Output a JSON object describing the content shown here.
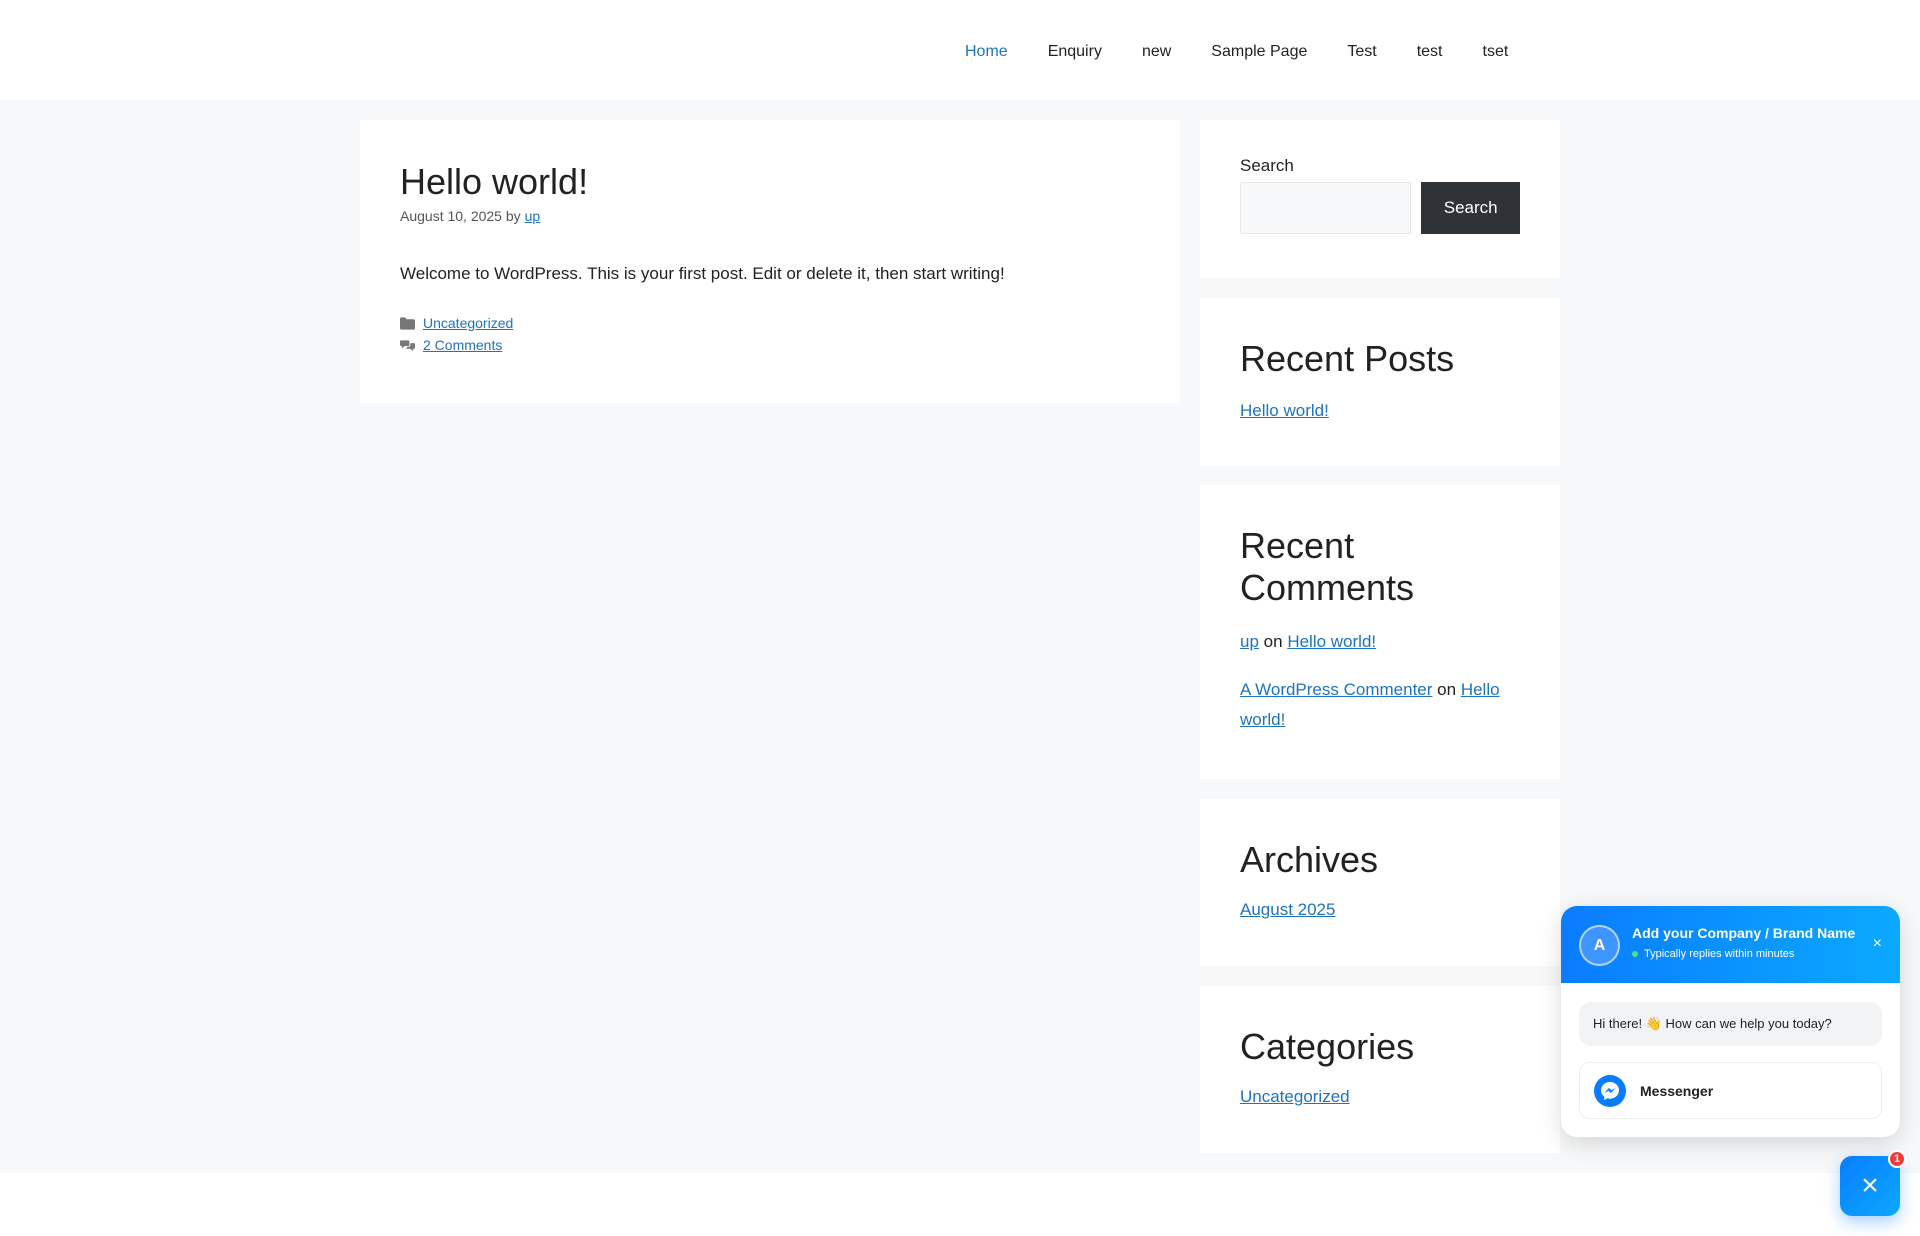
{
  "nav": {
    "items": [
      {
        "label": "Home"
      },
      {
        "label": "Enquiry"
      },
      {
        "label": "new"
      },
      {
        "label": "Sample Page"
      },
      {
        "label": "Test"
      },
      {
        "label": "test"
      },
      {
        "label": "tset"
      }
    ],
    "active": "Home"
  },
  "post": {
    "title": "Hello world!",
    "date": "August 10, 2025",
    "by": "by",
    "author": "up",
    "body": "Welcome to WordPress. This is your first post. Edit or delete it, then start writing!",
    "category": "Uncategorized",
    "comments": "2 Comments",
    "category_icon": "folder-icon",
    "comments_icon": "comments-icon"
  },
  "sidebar": {
    "search": {
      "label": "Search",
      "button": "Search",
      "value": ""
    },
    "recent_posts": {
      "title": "Recent Posts",
      "items": [
        "Hello world!"
      ]
    },
    "recent_comments": {
      "title": "Recent Comments",
      "items": [
        {
          "author": "up",
          "on": "on",
          "post": "Hello world!"
        },
        {
          "author": "A WordPress Commenter",
          "on": "on",
          "post": "Hello world!"
        }
      ]
    },
    "archives": {
      "title": "Archives",
      "items": [
        "August 2025"
      ]
    },
    "categories": {
      "title": "Categories",
      "items": [
        "Uncategorized"
      ]
    }
  },
  "chat": {
    "avatar_letter": "A",
    "brand": "Add your Company / Brand Name",
    "status": "Typically replies within minutes",
    "close": "×",
    "greeting": "Hi there! 👋 How can we help you today?",
    "channel": "Messenger",
    "fab_close": "×",
    "badge_count": "1",
    "colors": {
      "primary": "#0a7cff",
      "secondary": "#0ba9ff",
      "badge": "#f23a3a",
      "online": "#4ee07a"
    }
  },
  "colors": {
    "link": "#1e73be",
    "page_bg": "#f7f8f9",
    "button_dark": "#2f3236"
  }
}
